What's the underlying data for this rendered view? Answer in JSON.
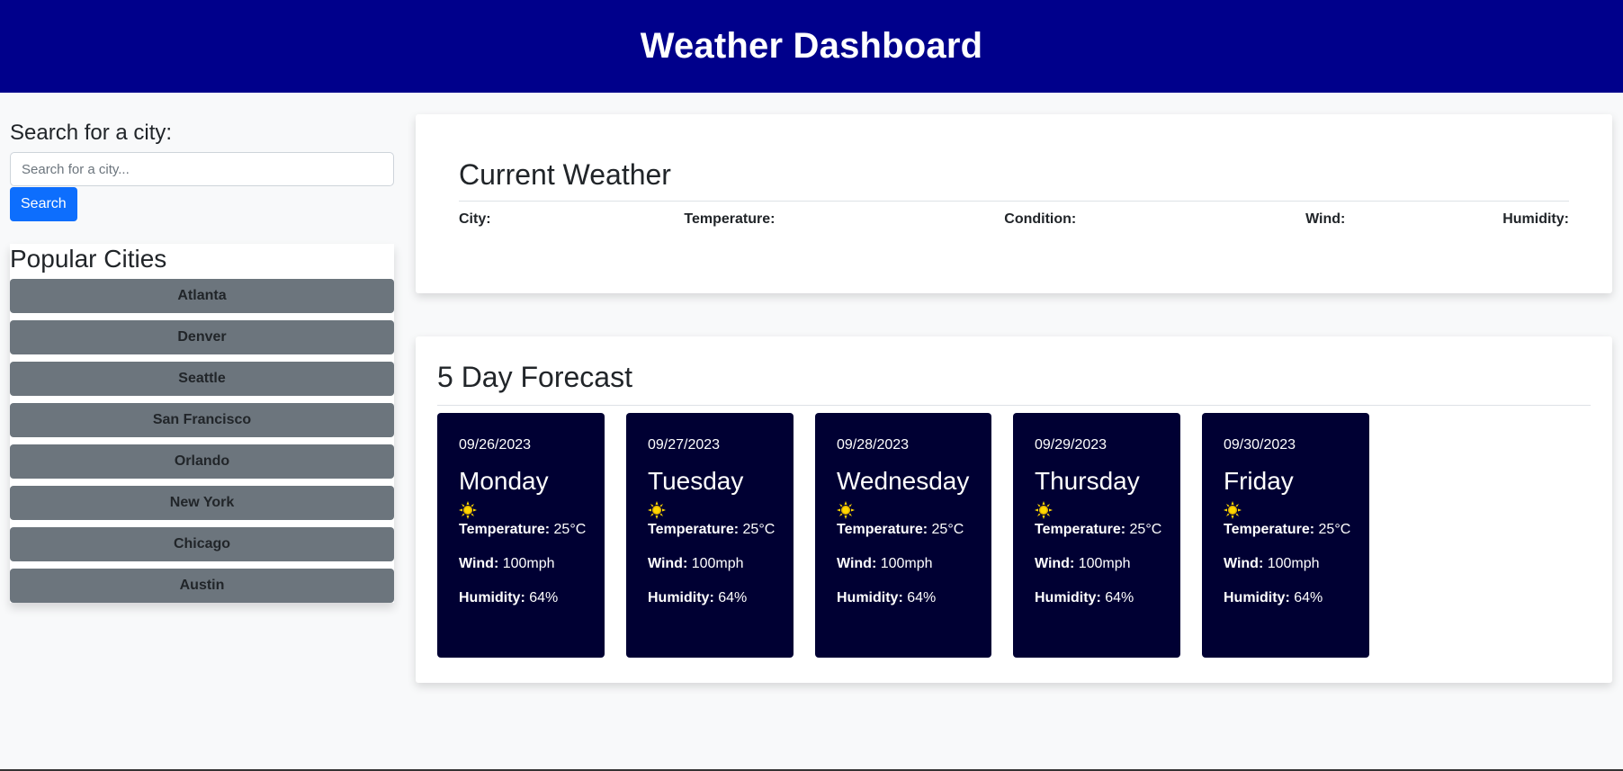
{
  "header": {
    "title": "Weather Dashboard"
  },
  "search": {
    "label": "Search for a city:",
    "placeholder": "Search for a city...",
    "value": "",
    "button_label": "Search"
  },
  "popular": {
    "title": "Popular Cities",
    "cities": [
      "Atlanta",
      "Denver",
      "Seattle",
      "San Francisco",
      "Orlando",
      "New York",
      "Chicago",
      "Austin"
    ]
  },
  "current": {
    "title": "Current Weather",
    "fields": {
      "city": "City:",
      "temperature": "Temperature:",
      "condition": "Condition:",
      "wind": "Wind:",
      "humidity": "Humidity:"
    }
  },
  "forecast": {
    "title": "5 Day Forecast",
    "labels": {
      "temperature": "Temperature:",
      "wind": "Wind:",
      "humidity": "Humidity:"
    },
    "days": [
      {
        "date": "09/26/2023",
        "day": "Monday",
        "icon": "sun-icon",
        "temperature": "25°C",
        "wind": "100mph",
        "humidity": "64%"
      },
      {
        "date": "09/27/2023",
        "day": "Tuesday",
        "icon": "sun-icon",
        "temperature": "25°C",
        "wind": "100mph",
        "humidity": "64%"
      },
      {
        "date": "09/28/2023",
        "day": "Wednesday",
        "icon": "sun-icon",
        "temperature": "25°C",
        "wind": "100mph",
        "humidity": "64%"
      },
      {
        "date": "09/29/2023",
        "day": "Thursday",
        "icon": "sun-icon",
        "temperature": "25°C",
        "wind": "100mph",
        "humidity": "64%"
      },
      {
        "date": "09/30/2023",
        "day": "Friday",
        "icon": "sun-icon",
        "temperature": "25°C",
        "wind": "100mph",
        "humidity": "64%"
      }
    ]
  },
  "colors": {
    "header_bg": "#00008b",
    "search_button": "#0d6efd",
    "city_button": "#6c757d",
    "forecast_card_bg": "#000033",
    "sun": "#ffd700"
  }
}
